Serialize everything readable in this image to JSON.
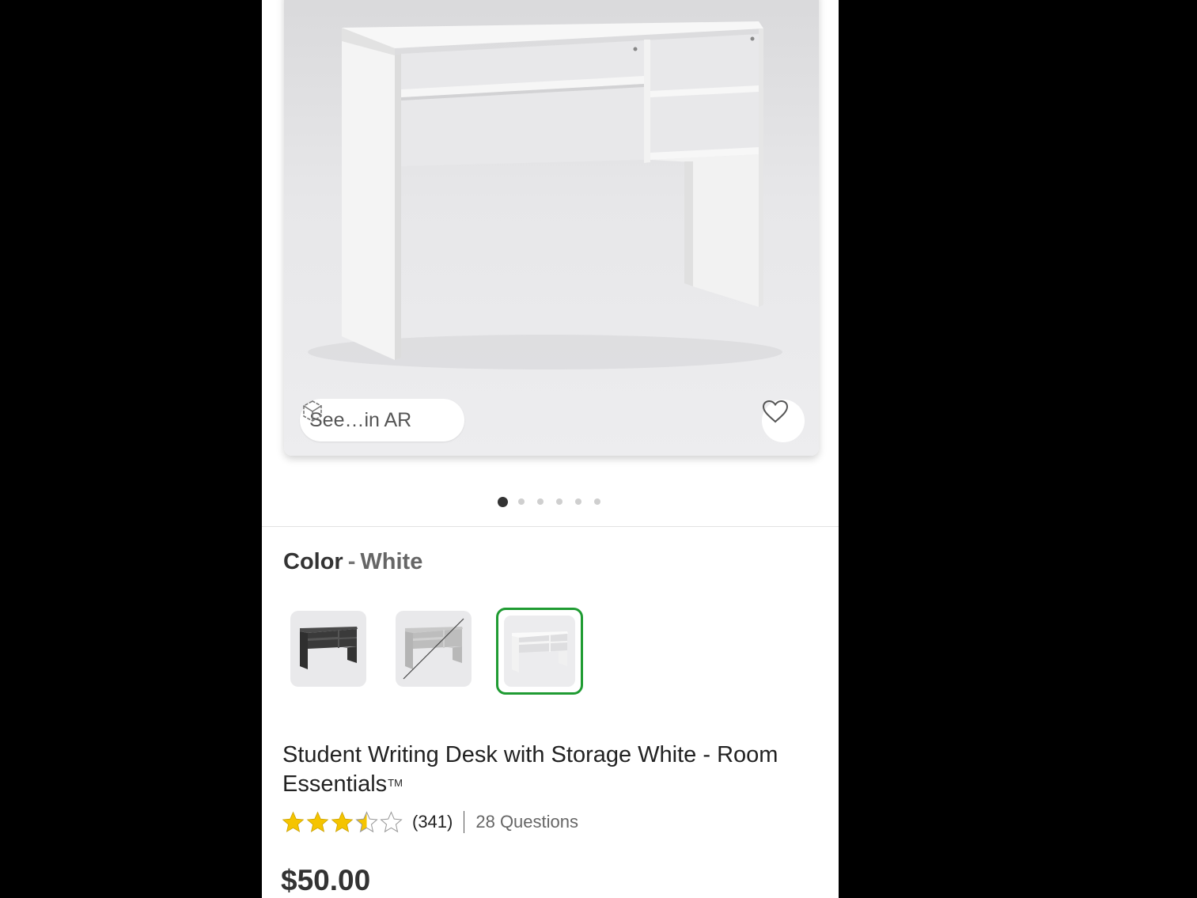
{
  "product_image": {
    "ar_button_label": "See…in AR",
    "ar_icon": "ar-cube-icon",
    "favorite_icon": "heart-outline-icon"
  },
  "carousel": {
    "total_images": 6,
    "active_index": 0
  },
  "color_selector": {
    "label": "Color",
    "separator": "-",
    "selected_value": "White",
    "options": [
      {
        "name": "Black",
        "available": true,
        "selected": false
      },
      {
        "name": "Gray",
        "available": false,
        "selected": false
      },
      {
        "name": "White",
        "available": true,
        "selected": true
      }
    ],
    "selected_border_color": "#1f9b32"
  },
  "product": {
    "title": "Student Writing Desk with Storage White - Room Essentials",
    "trademark": "TM",
    "rating": 3.5,
    "rating_max": 5,
    "review_count": "(341)",
    "questions": "28 Questions",
    "price": "$50.00"
  },
  "colors": {
    "star_fill": "#f5c400",
    "text_dark": "#222222",
    "text_muted": "#666666"
  }
}
